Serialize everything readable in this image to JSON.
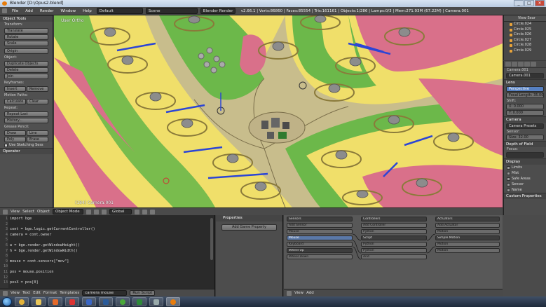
{
  "window": {
    "title": "Blender [D:\\Opus2.blend]",
    "controls": [
      "_",
      "□",
      "×"
    ]
  },
  "infobar": {
    "menus": [
      "File",
      "Add",
      "Render",
      "Window",
      "Help"
    ],
    "layout": "Default",
    "scene": "Scene",
    "engine": "Blender Render",
    "stats": "v2.66.1 | Verts:86860 | Faces:85554 | Tris:161161 | Objects:1/286 | Lamps:0/3 | Mem:271.93M (67.22M) | Camera.001"
  },
  "toolshelf": {
    "title": "Object Tools",
    "sections": [
      {
        "name": "Transform:",
        "buttons": [
          "Translate",
          "Rotate",
          "Scale"
        ]
      },
      {
        "name": "",
        "buttons": [
          "Origin"
        ]
      },
      {
        "name": "Object:",
        "buttons": [
          "Duplicate Objects",
          "Delete",
          "Join"
        ]
      },
      {
        "name": "Keyframes:",
        "pair": [
          "Insert",
          "Remove"
        ]
      },
      {
        "name": "Motion Paths:",
        "pair": [
          "Calculate",
          "Clear"
        ]
      },
      {
        "name": "Repeat:",
        "buttons": [
          "Repeat Last",
          "History..."
        ]
      },
      {
        "name": "Grease Pencil:",
        "pair": [
          "Draw",
          "Line"
        ],
        "pair2": [
          "Poly",
          "Erase"
        ],
        "check": "Use Sketching Sess"
      }
    ],
    "operator": "Operator"
  },
  "viewport": {
    "label": "User Ortho",
    "camera": "(184) Camera.001"
  },
  "vpheader": {
    "menus": [
      "View",
      "Select",
      "Object"
    ],
    "mode": "Object Mode",
    "orientation": "Global"
  },
  "outliner": {
    "menus": [
      "View",
      "Sear"
    ],
    "items": [
      "Circle.024",
      "Circle.025",
      "Circle.026",
      "Circle.027",
      "Circle.028",
      "Circle.029"
    ]
  },
  "properties": {
    "object": "Camera.001",
    "datablock": "Camera.001",
    "lens_section": "Lens",
    "perspective": "Perspective",
    "focal": "Focal Length: 35.000",
    "shift": "Shift:",
    "shift_x": "X: 0.000",
    "shift_y": "Y: 0.000",
    "camera_section": "Camera",
    "presets": "Camera Presets",
    "sensor": "Sensor:",
    "size": "Size: 32.00",
    "dof_section": "Depth of Field",
    "focus": "Focus:",
    "display_section": "Display",
    "display_items": [
      "Limits",
      "Mist",
      "Safe Areas",
      "Sensor",
      "Name"
    ],
    "custom_section": "Custom Properties"
  },
  "texteditor": {
    "line_numbers": "1\n2\n3\n4\n5\n6\n7\n8\n9\n10\n11\n12\n13",
    "code": "import bge\n\ncont = bge.logic.getCurrentController()\ncamera = cont.owner\n\nw = bge.render.getWindowHeight()\nh = bge.render.getWindowWidth()\n\nmouse = cont.sensors[\"mov\"]\n\npos = mouse.position\n\nposX = pos[0]",
    "menus": [
      "View",
      "Text",
      "Edit",
      "Format",
      "Templates"
    ],
    "file": "camera mouse",
    "run": "Run Script"
  },
  "gameprops": {
    "title": "Properties",
    "add": "Add Game Property"
  },
  "logic": {
    "sensors_hdr": "Sensors",
    "controllers_hdr": "Controllers",
    "actuators_hdr": "Actuators",
    "sensor_bricks": [
      "Add Sensor",
      "Mouse",
      "Mouse",
      "Keyboard",
      "Wheel Up",
      "Wheel Down"
    ],
    "controller_bricks": [
      "Add Controller",
      "Python",
      "Script",
      "Python",
      "Python",
      "And"
    ],
    "actuator_bricks": [
      "Add Actuator",
      "Motion",
      "Simple Motion",
      "Motion",
      "Motion"
    ],
    "menus": [
      "View",
      "Add"
    ]
  },
  "colors": {
    "ui_bg": "#4d4d4d",
    "accent": "#5680c2",
    "pink_zone": "#d9708a",
    "yellow_zone": "#f0df6a",
    "green_zone": "#6cb84a",
    "road": "#c8bd8c"
  }
}
